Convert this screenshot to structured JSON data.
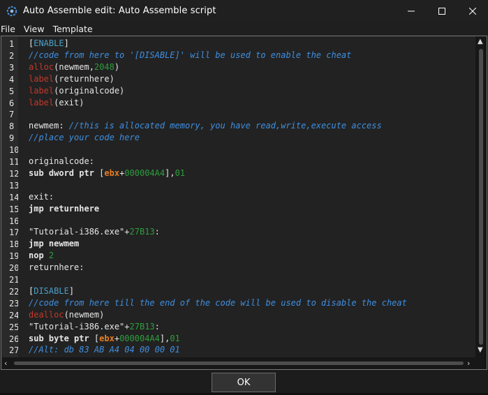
{
  "window": {
    "title": "Auto Assemble edit: Auto Assemble script",
    "app_icon": "cheat-engine-icon"
  },
  "menu": [
    "File",
    "View",
    "Template"
  ],
  "editor": {
    "line_numbers": [
      "1",
      "2",
      "3",
      "4",
      "5",
      "6",
      "7",
      "8",
      "9",
      "10",
      "11",
      "12",
      "13",
      "14",
      "15",
      "16",
      "17",
      "18",
      "19",
      "20",
      "21",
      "22",
      "23",
      "24",
      "25",
      "26",
      "27"
    ],
    "lines": [
      [
        {
          "t": "[",
          "c": "plain"
        },
        {
          "t": "ENABLE",
          "c": "k"
        },
        {
          "t": "]",
          "c": "plain"
        }
      ],
      [
        {
          "t": "//code from here to '[DISABLE]' will be used to enable the cheat",
          "c": "cm"
        }
      ],
      [
        {
          "t": "alloc",
          "c": "fn"
        },
        {
          "t": "(newmem,",
          "c": "plain"
        },
        {
          "t": "2048",
          "c": "num"
        },
        {
          "t": ")",
          "c": "plain"
        }
      ],
      [
        {
          "t": "label",
          "c": "fn"
        },
        {
          "t": "(returnhere)",
          "c": "plain"
        }
      ],
      [
        {
          "t": "label",
          "c": "fn"
        },
        {
          "t": "(originalcode)",
          "c": "plain"
        }
      ],
      [
        {
          "t": "label",
          "c": "fn"
        },
        {
          "t": "(exit)",
          "c": "plain"
        }
      ],
      [],
      [
        {
          "t": "newmem: ",
          "c": "plain"
        },
        {
          "t": "//this is allocated memory, you have read,write,execute access",
          "c": "cm"
        }
      ],
      [
        {
          "t": "//place your code here",
          "c": "cm"
        }
      ],
      [],
      [
        {
          "t": "originalcode:",
          "c": "plain"
        }
      ],
      [
        {
          "t": "sub dword ptr ",
          "c": "kw"
        },
        {
          "t": "[",
          "c": "plain"
        },
        {
          "t": "ebx",
          "c": "reg"
        },
        {
          "t": "+",
          "c": "plain"
        },
        {
          "t": "000004A4",
          "c": "num"
        },
        {
          "t": "],",
          "c": "plain"
        },
        {
          "t": "01",
          "c": "num"
        }
      ],
      [],
      [
        {
          "t": "exit:",
          "c": "plain"
        }
      ],
      [
        {
          "t": "jmp ",
          "c": "kw"
        },
        {
          "t": "returnhere",
          "c": "kw"
        }
      ],
      [],
      [
        {
          "t": "\"Tutorial-i386.exe\"",
          "c": "plain"
        },
        {
          "t": "+",
          "c": "plain"
        },
        {
          "t": "27B13",
          "c": "num"
        },
        {
          "t": ":",
          "c": "plain"
        }
      ],
      [
        {
          "t": "jmp ",
          "c": "kw"
        },
        {
          "t": "newmem",
          "c": "kw"
        }
      ],
      [
        {
          "t": "nop ",
          "c": "kw"
        },
        {
          "t": "2",
          "c": "num"
        }
      ],
      [
        {
          "t": "returnhere:",
          "c": "plain"
        }
      ],
      [],
      [
        {
          "t": "[",
          "c": "plain"
        },
        {
          "t": "DISABLE",
          "c": "k"
        },
        {
          "t": "]",
          "c": "plain"
        }
      ],
      [
        {
          "t": "//code from here till the end of the code will be used to disable the cheat",
          "c": "cm"
        }
      ],
      [
        {
          "t": "dealloc",
          "c": "fn"
        },
        {
          "t": "(newmem)",
          "c": "plain"
        }
      ],
      [
        {
          "t": "\"Tutorial-i386.exe\"",
          "c": "plain"
        },
        {
          "t": "+",
          "c": "plain"
        },
        {
          "t": "27B13",
          "c": "num"
        },
        {
          "t": ":",
          "c": "plain"
        }
      ],
      [
        {
          "t": "sub byte ptr ",
          "c": "kw"
        },
        {
          "t": "[",
          "c": "plain"
        },
        {
          "t": "ebx",
          "c": "reg"
        },
        {
          "t": "+",
          "c": "plain"
        },
        {
          "t": "000004A4",
          "c": "num"
        },
        {
          "t": "],",
          "c": "plain"
        },
        {
          "t": "01",
          "c": "num"
        }
      ],
      [
        {
          "t": "//Alt: db 83 AB A4 04 00 00 01",
          "c": "cm"
        }
      ]
    ]
  },
  "buttons": {
    "ok_label": "OK"
  },
  "colors": {
    "background": "#1c1c1c",
    "comment": "#3f8fe0",
    "function": "#c0392b",
    "number": "#2e9e3e",
    "register": "#e67e22"
  }
}
